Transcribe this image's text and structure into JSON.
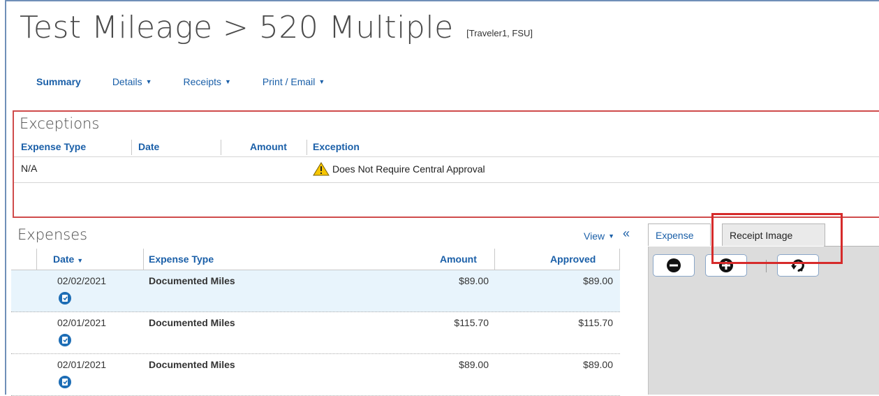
{
  "header": {
    "title": "Test Mileage > 520 Multiple",
    "subtitle": "[Traveler1, FSU]"
  },
  "menu": {
    "summary": "Summary",
    "details": "Details",
    "receipts": "Receipts",
    "print_email": "Print / Email"
  },
  "exceptions": {
    "title": "Exceptions",
    "columns": [
      "Expense Type",
      "Date",
      "Amount",
      "Exception"
    ],
    "rows": [
      {
        "expense_type": "N/A",
        "date": "",
        "amount": "",
        "exception": "Does Not Require Central Approval"
      }
    ]
  },
  "expenses": {
    "title": "Expenses",
    "view_label": "View",
    "collapse_glyph": "«",
    "columns": {
      "date": "Date",
      "expense_type": "Expense Type",
      "amount": "Amount",
      "approved": "Approved"
    },
    "rows": [
      {
        "date": "02/02/2021",
        "expense_type": "Documented Miles",
        "amount": "$89.00",
        "approved": "$89.00",
        "selected": true
      },
      {
        "date": "02/01/2021",
        "expense_type": "Documented Miles",
        "amount": "$115.70",
        "approved": "$115.70",
        "selected": false
      },
      {
        "date": "02/01/2021",
        "expense_type": "Documented Miles",
        "amount": "$89.00",
        "approved": "$89.00",
        "selected": false
      }
    ]
  },
  "right_panel": {
    "tabs": [
      "Expense",
      "Receipt Image"
    ],
    "active_tab": "Receipt Image",
    "toolbar": [
      "zoom-out-icon",
      "zoom-in-icon",
      "rotate-icon"
    ]
  },
  "colors": {
    "link": "#1a5fa8",
    "highlight": "#d62b2b",
    "exceptions_border": "#cf4b4b",
    "selected_row": "#e8f4fc",
    "panel_bg": "#dcdcdc"
  }
}
